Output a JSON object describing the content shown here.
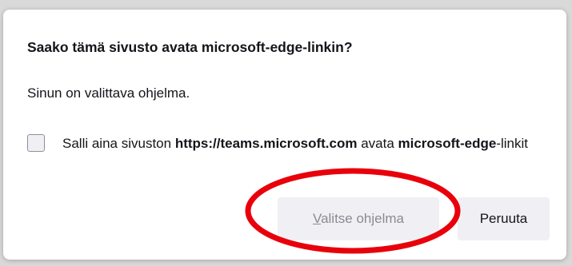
{
  "dialog": {
    "title": "Saako tämä sivusto avata microsoft-edge-linkin?",
    "message": "Sinun on valittava ohjelma.",
    "checkbox": {
      "checked": false,
      "label_prefix": "Salli aina sivuston ",
      "label_site": "https://teams.microsoft.com",
      "label_middle": " avata ",
      "label_scheme": "microsoft-edge",
      "label_suffix": "-linkit"
    },
    "buttons": {
      "choose_access_key": "V",
      "choose_rest": "alitse ohjelma",
      "cancel": "Peruuta"
    }
  },
  "annotation": {
    "color": "#e8000b"
  }
}
